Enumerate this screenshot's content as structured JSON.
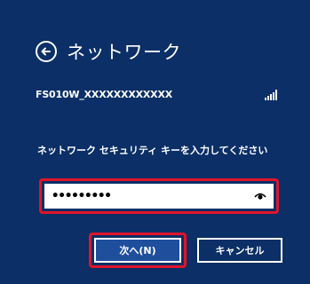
{
  "header": {
    "title": "ネットワーク",
    "back_icon": "back-arrow-circle-icon"
  },
  "network": {
    "ssid": "FS010W_XXXXXXXXXXXX",
    "signal_icon": "signal-strength-icon"
  },
  "security": {
    "prompt": "ネットワーク セキュリティ キーを入力してください",
    "password_masked": "•••••••••",
    "reveal_icon": "eye-icon"
  },
  "buttons": {
    "next_label": "次へ(N)",
    "cancel_label": "キャンセル"
  },
  "colors": {
    "background": "#0b2f66",
    "highlight": "#e0142a",
    "primary_button": "#1f4e9c"
  }
}
